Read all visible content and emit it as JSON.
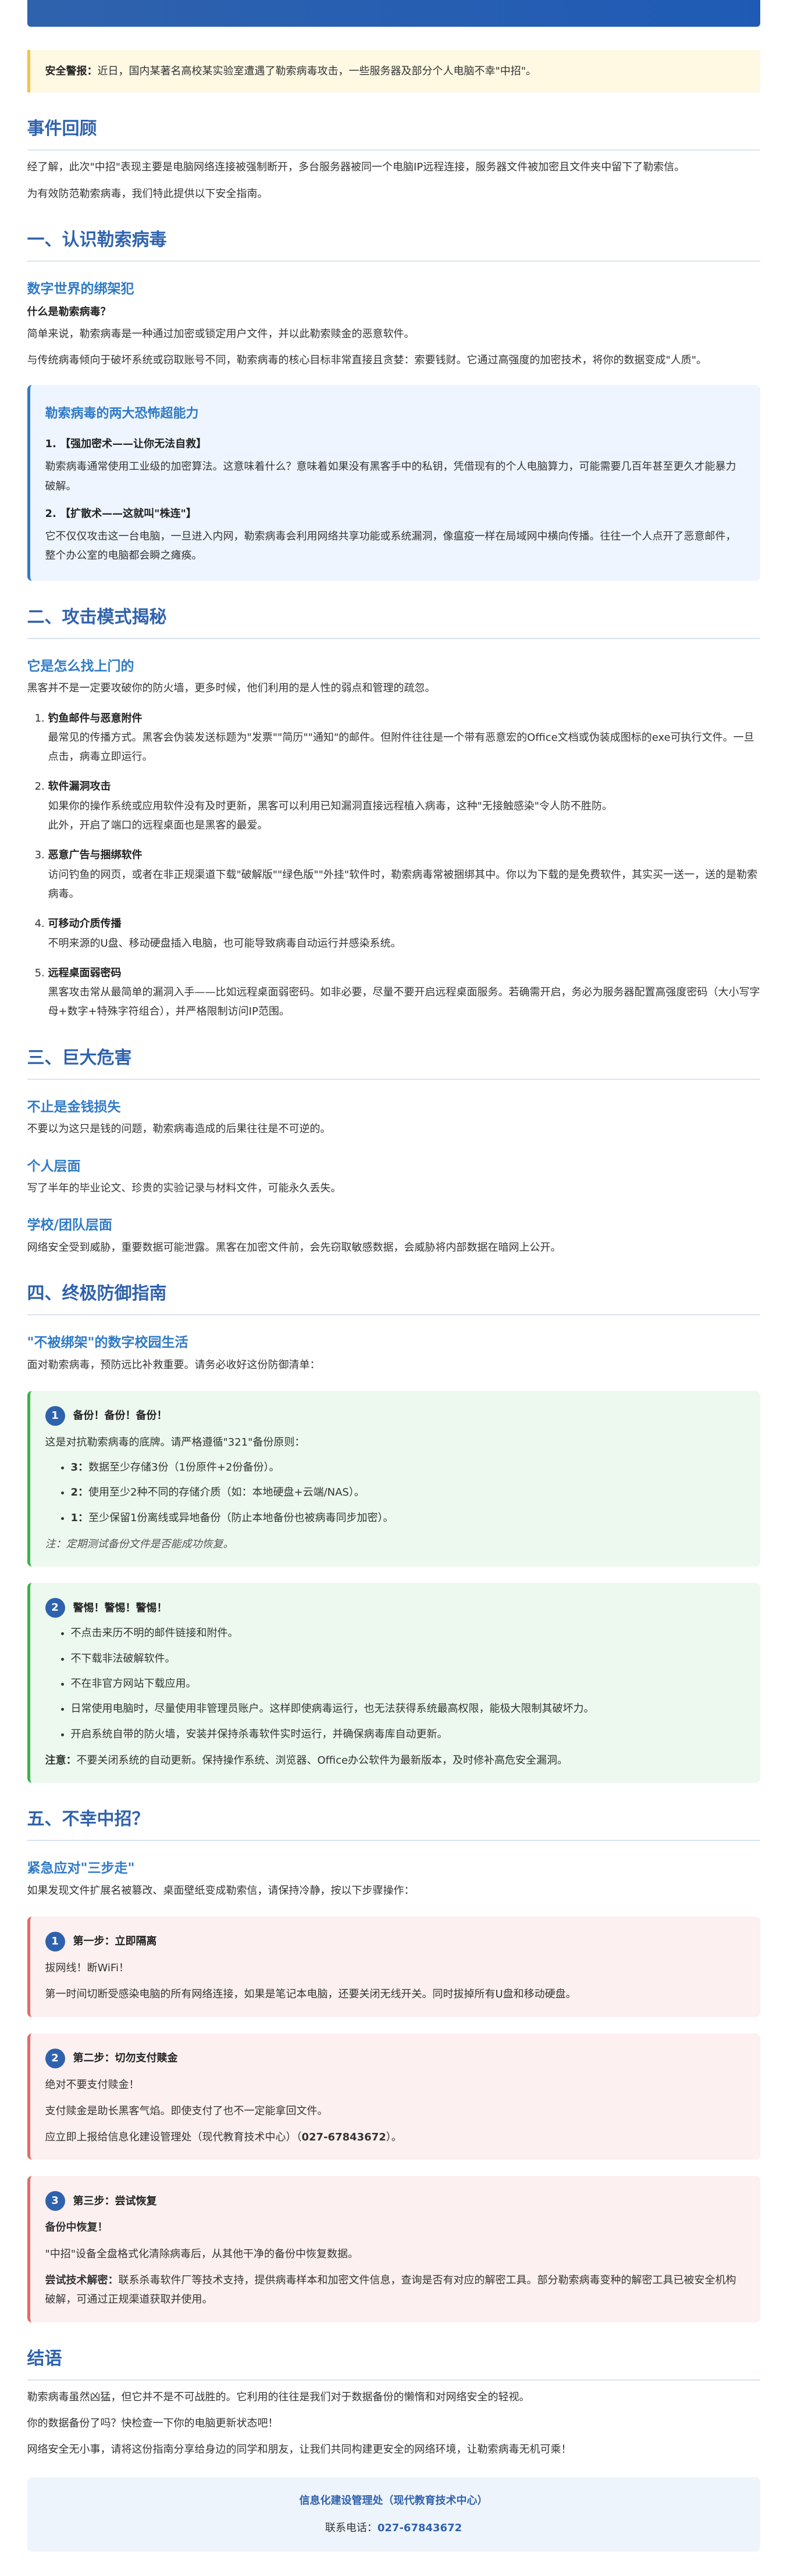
{
  "alert": {
    "label": "安全警报：",
    "text": "近日，国内某著名高校某实验室遭遇了勒索病毒攻击，一些服务器及部分个人电脑不幸\"中招\"。"
  },
  "review": {
    "title": "事件回顾",
    "p1": "经了解，此次\"中招\"表现主要是电脑网络连接被强制断开，多台服务器被同一个电脑IP远程连接，服务器文件被加密且文件夹中留下了勒索信。",
    "p2": "为有效防范勒索病毒，我们特此提供以下安全指南。"
  },
  "s1": {
    "title": "一、认识勒索病毒",
    "sub": "数字世界的绑架犯",
    "q": "什么是勒索病毒？",
    "p1": "简单来说，勒索病毒是一种通过加密或锁定用户文件，并以此勒索赎金的恶意软件。",
    "p2": "与传统病毒倾向于破坏系统或窃取账号不同，勒索病毒的核心目标非常直接且贪婪：索要钱财。它通过高强度的加密技术，将你的数据变成\"人质\"。",
    "box": {
      "title": "勒索病毒的两大恐怖超能力",
      "l1": "1. 【强加密术——让你无法自救】",
      "d1": "勒索病毒通常使用工业级的加密算法。这意味着什么？意味着如果没有黑客手中的私钥，凭借现有的个人电脑算力，可能需要几百年甚至更久才能暴力破解。",
      "l2": "2. 【扩散术——这就叫\"株连\"】",
      "d2": "它不仅仅攻击这一台电脑，一旦进入内网，勒索病毒会利用网络共享功能或系统漏洞，像瘟疫一样在局域网中横向传播。往往一个人点开了恶意邮件，整个办公室的电脑都会瞬之瘫痪。"
    }
  },
  "s2": {
    "title": "二、攻击模式揭秘",
    "sub": "它是怎么找上门的",
    "intro": "黑客并不是一定要攻破你的防火墙，更多时候，他们利用的是人性的弱点和管理的疏忽。",
    "items": [
      {
        "t": "钓鱼邮件与恶意附件",
        "d": "最常见的传播方式。黑客会伪装发送标题为\"发票\"\"简历\"\"通知\"的邮件。但附件往往是一个带有恶意宏的Office文档或伪装成图标的exe可执行文件。一旦点击，病毒立即运行。"
      },
      {
        "t": "软件漏洞攻击",
        "d": "如果你的操作系统或应用软件没有及时更新，黑客可以利用已知漏洞直接远程植入病毒，这种\"无接触感染\"令人防不胜防。",
        "d2": "此外，开启了端口的远程桌面也是黑客的最爱。"
      },
      {
        "t": "恶意广告与捆绑软件",
        "d": "访问钓鱼的网页，或者在非正规渠道下载\"破解版\"\"绿色版\"\"外挂\"软件时，勒索病毒常被捆绑其中。你以为下载的是免费软件，其实买一送一，送的是勒索病毒。"
      },
      {
        "t": "可移动介质传播",
        "d": "不明来源的U盘、移动硬盘插入电脑，也可能导致病毒自动运行并感染系统。"
      },
      {
        "t": "远程桌面弱密码",
        "d": "黑客攻击常从最简单的漏洞入手——比如远程桌面弱密码。如非必要，尽量不要开启远程桌面服务。若确需开启，务必为服务器配置高强度密码（大小写字母+数字+特殊字符组合），并严格限制访问IP范围。"
      }
    ]
  },
  "s3": {
    "title": "三、巨大危害",
    "sub1": "不止是金钱损失",
    "p1": "不要以为这只是钱的问题，勒索病毒造成的后果往往是不可逆的。",
    "sub2": "个人层面",
    "p2": "写了半年的毕业论文、珍贵的实验记录与材料文件，可能永久丢失。",
    "sub3": "学校/团队层面",
    "p3": "网络安全受到威胁，重要数据可能泄露。黑客在加密文件前，会先窃取敏感数据，会威胁将内部数据在暗网上公开。"
  },
  "s4": {
    "title": "四、终极防御指南",
    "sub": "\"不被绑架\"的数字校园生活",
    "intro": "面对勒索病毒，预防远比补救重要。请务必收好这份防御清单：",
    "card1": {
      "num": "1",
      "title": "备份！备份！备份！",
      "lead": "这是对抗勒索病毒的底牌。请严格遵循\"321\"备份原则：",
      "items": [
        {
          "k": "3：",
          "v": "数据至少存储3份（1份原件+2份备份）。"
        },
        {
          "k": "2：",
          "v": "使用至少2种不同的存储介质（如：本地硬盘+云端/NAS）。"
        },
        {
          "k": "1：",
          "v": "至少保留1份离线或异地备份（防止本地备份也被病毒同步加密）。"
        }
      ],
      "note": "注：定期测试备份文件是否能成功恢复。"
    },
    "card2": {
      "num": "2",
      "title": "警惕！警惕！警惕！",
      "items": [
        "不点击来历不明的邮件链接和附件。",
        "不下载非法破解软件。",
        "不在非官方网站下载应用。",
        "日常使用电脑时，尽量使用非管理员账户。这样即使病毒运行，也无法获得系统最高权限，能极大限制其破坏力。",
        "开启系统自带的防火墙，安装并保持杀毒软件实时运行，并确保病毒库自动更新。"
      ],
      "note_label": "注意：",
      "note": "不要关闭系统的自动更新。保持操作系统、浏览器、Office办公软件为最新版本，及时修补高危安全漏洞。"
    }
  },
  "s5": {
    "title": "五、不幸中招？",
    "sub": "紧急应对\"三步走\"",
    "intro": "如果发现文件扩展名被篡改、桌面壁纸变成勒索信，请保持冷静，按以下步骤操作：",
    "card1": {
      "num": "1",
      "title": "第一步：立即隔离",
      "lead": "拔网线！断WiFi！",
      "p": "第一时间切断受感染电脑的所有网络连接，如果是笔记本电脑，还要关闭无线开关。同时拔掉所有U盘和移动硬盘。"
    },
    "card2": {
      "num": "2",
      "title": "第二步：切勿支付赎金",
      "p1": "绝对不要支付赎金！",
      "p2": "支付赎金是助长黑客气焰。即使支付了也不一定能拿回文件。",
      "p3_pre": "应立即上报给信息化建设管理处（现代教育技术中心）（",
      "p3_tel": "027-67843672",
      "p3_post": "）。"
    },
    "card3": {
      "num": "3",
      "title": "第三步：尝试恢复",
      "lead": "备份中恢复！",
      "p1": "\"中招\"设备全盘格式化清除病毒后，从其他干净的备份中恢复数据。",
      "p2_label": "尝试技术解密：",
      "p2": "联系杀毒软件厂等技术支持，提供病毒样本和加密文件信息，查询是否有对应的解密工具。部分勒索病毒变种的解密工具已被安全机构破解，可通过正规渠道获取并使用。"
    }
  },
  "conclusion": {
    "title": "结语",
    "p1": "勒索病毒虽然凶猛，但它并不是不可战胜的。它利用的往往是我们对于数据备份的懒惰和对网络安全的轻视。",
    "p2": "你的数据备份了吗？快检查一下你的电脑更新状态吧！",
    "p3": "网络安全无小事，请将这份指南分享给身边的同学和朋友，让我们共同构建更安全的网络环境，让勒索病毒无机可乘！"
  },
  "footer": {
    "org": "信息化建设管理处（现代教育技术中心）",
    "tel_label": "联系电话：",
    "tel": "027-67843672"
  }
}
